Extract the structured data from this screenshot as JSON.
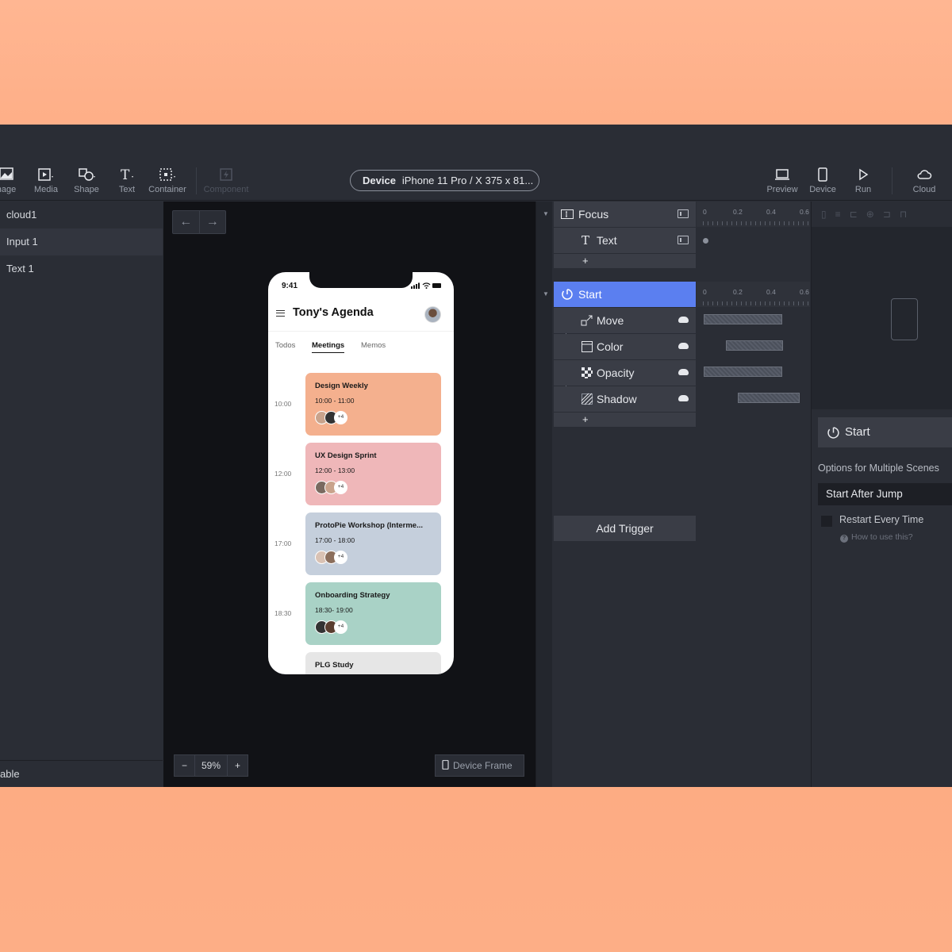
{
  "toolbar": {
    "tools": [
      {
        "label": "nage",
        "icon": "image-icon"
      },
      {
        "label": "Media",
        "icon": "media-icon"
      },
      {
        "label": "Shape",
        "icon": "shape-icon"
      },
      {
        "label": "Text",
        "icon": "text-icon"
      },
      {
        "label": "Container",
        "icon": "container-icon"
      },
      {
        "label": "Component",
        "icon": "component-icon"
      }
    ],
    "device_label": "Device",
    "device_value": "iPhone 11 Pro / X  375 x 81...",
    "right_tools": [
      {
        "label": "Preview",
        "icon": "preview-icon"
      },
      {
        "label": "Device",
        "icon": "device-icon"
      },
      {
        "label": "Run",
        "icon": "run-icon"
      },
      {
        "label": "Cloud",
        "icon": "cloud-icon"
      }
    ]
  },
  "layers": {
    "items": [
      "cloud1",
      "Input 1",
      "Text 1"
    ],
    "selected": "Input 1",
    "footer": "able"
  },
  "canvas": {
    "zoom_minus": "−",
    "zoom_value": "59%",
    "zoom_plus": "+",
    "device_frame": "Device Frame"
  },
  "phone": {
    "time": "9:41",
    "title": "Tony's Agenda",
    "tabs": [
      "Todos",
      "Meetings",
      "Memos"
    ],
    "active_tab": "Meetings",
    "meetings": [
      {
        "hour": "10:00",
        "title": "Design Weekly",
        "time": "10:00 - 11:00",
        "more": "+4",
        "color": "#f4b08e"
      },
      {
        "hour": "12:00",
        "title": "UX Design Sprint",
        "time": "12:00 - 13:00",
        "more": "+4",
        "color": "#efb7b9"
      },
      {
        "hour": "17:00",
        "title": "ProtoPie Workshop (Interme...",
        "time": "17:00 - 18:00",
        "more": "+4",
        "color": "#c5cfdc"
      },
      {
        "hour": "18:30",
        "title": "Onboarding Strategy",
        "time": "18:30- 19:00",
        "more": "+4",
        "color": "#a9d2c6"
      },
      {
        "hour": "",
        "title": "PLG Study",
        "time": "",
        "more": "",
        "color": "#e6e6e6"
      }
    ]
  },
  "interactions": {
    "triggers": [
      {
        "label": "Focus",
        "responses": [
          {
            "label": "Text"
          }
        ]
      },
      {
        "label": "Start",
        "responses": [
          {
            "label": "Move"
          },
          {
            "label": "Color"
          },
          {
            "label": "Opacity"
          },
          {
            "label": "Shadow"
          }
        ]
      }
    ],
    "add_response": "+",
    "add_trigger": "Add Trigger",
    "timeline_ticks": [
      "0",
      "0.2",
      "0.4",
      "0.6"
    ]
  },
  "properties": {
    "trigger_title": "Start",
    "options_label": "Options for Multiple Scenes",
    "option_value": "Start After Jump",
    "checkbox_label": "Restart Every Time",
    "checkbox_checked": false,
    "help_text": "How to use this?"
  },
  "colors": {
    "accent": "#5b7ff0",
    "panel_bg": "#2a2d35",
    "canvas_bg": "#111216"
  }
}
